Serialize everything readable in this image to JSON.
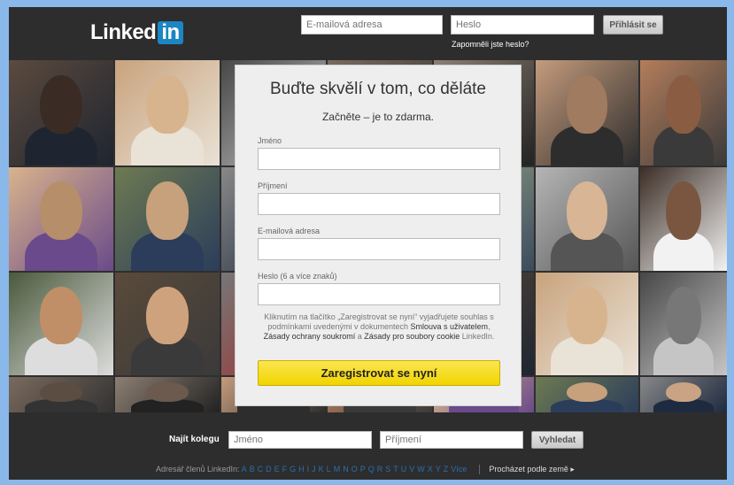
{
  "header": {
    "logo_text": "Linked",
    "logo_in": "in",
    "email_placeholder": "E-mailová adresa",
    "password_placeholder": "Heslo",
    "login_button": "Přihlásit se",
    "forgot_password": "Zapomněli jste heslo?"
  },
  "card": {
    "title": "Buďte skvělí v tom, co děláte",
    "subtitle": "Začněte – je to zdarma.",
    "fields": [
      {
        "label": "Jméno"
      },
      {
        "label": "Příjmení"
      },
      {
        "label": "E-mailová adresa"
      },
      {
        "label": "Heslo (6 a více znaků)"
      }
    ],
    "terms": {
      "p1": "Kliknutím na tlačítko „Zaregistrovat se nyní“ vyjadřujete souhlas s podmínkami uvedenými v dokumentech ",
      "link1": "Smlouva s uživatelem",
      "p2": ", ",
      "link2": "Zásady ochrany soukromí",
      "p3": " a ",
      "link3": "Zásady pro soubory cookie",
      "p4": " LinkedIn."
    },
    "register_button": "Zaregistrovat se nyní"
  },
  "footer": {
    "find_colleague_label": "Najít kolegu",
    "first_name_placeholder": "Jméno",
    "last_name_placeholder": "Příjmení",
    "search_button": "Vyhledat",
    "directory_label": "Adresář členů LinkedIn:",
    "letters": [
      "A",
      "B",
      "C",
      "D",
      "E",
      "F",
      "G",
      "H",
      "I",
      "J",
      "K",
      "L",
      "M",
      "N",
      "O",
      "P",
      "Q",
      "R",
      "S",
      "T",
      "U",
      "V",
      "W",
      "X",
      "Y",
      "Z",
      "Více"
    ],
    "browse_by_country": "Procházet podle země ▸"
  },
  "colors": {
    "background": "#8ab8ea",
    "header": "#2d2d2d",
    "logo_in": "#1b86c3",
    "register_button": "#f1d400",
    "link": "#2a6fb0"
  }
}
